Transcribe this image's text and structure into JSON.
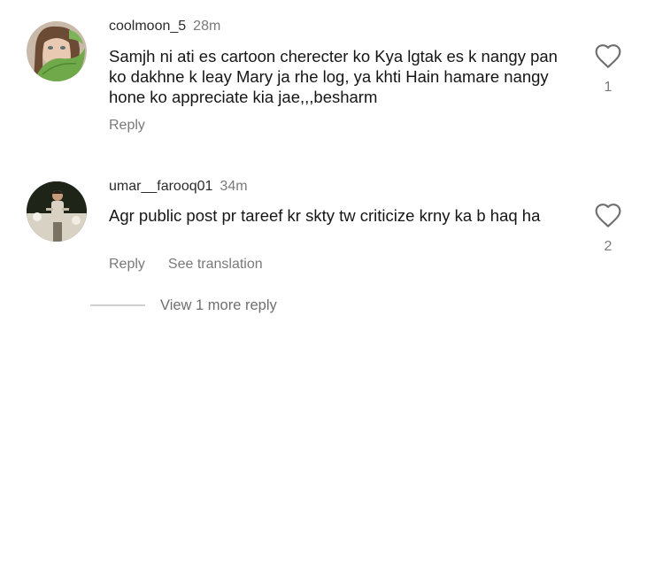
{
  "comments": [
    {
      "username": "coolmoon_5",
      "time": "28m",
      "text": "Samjh ni ati es cartoon cherecter ko Kya lgtak es k nangy pan ko dakhne k leay Mary ja rhe log, ya khti Hain hamare nangy hone ko appreciate kia jae,,,besharm",
      "reply_label": "Reply",
      "like_count": "1"
    },
    {
      "username": "umar__farooq01",
      "time": "34m",
      "text": "Agr public post pr tareef kr skty tw criticize krny ka b haq ha",
      "reply_label": "Reply",
      "translate_label": "See translation",
      "like_count": "2"
    }
  ],
  "view_more_replies": "View 1 more reply",
  "colors": {
    "text_primary": "#161616",
    "text_secondary": "#7a7a7a",
    "divider": "#cfcfcf"
  },
  "icons": {
    "like": "heart-outline-icon"
  }
}
